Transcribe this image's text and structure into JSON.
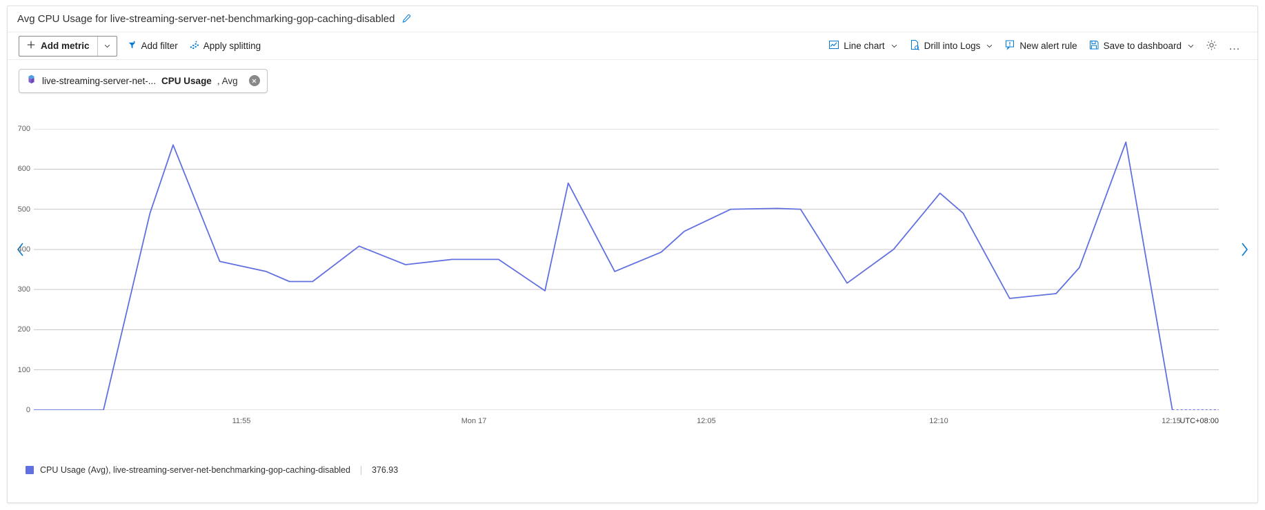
{
  "header": {
    "title": "Avg CPU Usage for live-streaming-server-net-benchmarking-gop-caching-disabled",
    "edit_icon": "pencil-icon"
  },
  "toolbar": {
    "add_metric_label": "Add metric",
    "add_filter_label": "Add filter",
    "apply_splitting_label": "Apply splitting",
    "chart_type_label": "Line chart",
    "drill_into_logs_label": "Drill into Logs",
    "new_alert_rule_label": "New alert rule",
    "save_to_dashboard_label": "Save to dashboard",
    "settings_icon": "gear-icon",
    "more_label": "…"
  },
  "metric_chip": {
    "resource_icon": "vm-resource-icon",
    "resource": "live-streaming-server-net-...",
    "metric": "CPU Usage",
    "aggregation": ", Avg",
    "close_icon": "close-icon"
  },
  "navigation": {
    "previous_icon": "chevron-left-icon",
    "next_icon": "chevron-right-icon"
  },
  "legend": {
    "swatch_color": "#6170e0",
    "text": "CPU Usage (Avg), live-streaming-server-net-benchmarking-gop-caching-disabled",
    "value": "376.93"
  },
  "colors": {
    "series": "#6170e0",
    "accent": "#0078d4",
    "grid": "#c8c6c4",
    "axis_text": "#605e5c"
  },
  "chart_data": {
    "type": "line",
    "title": "Avg CPU Usage for live-streaming-server-net-benchmarking-gop-caching-disabled",
    "xlabel": "",
    "ylabel": "",
    "timezone": "UTC+08:00",
    "ylim": [
      0,
      700
    ],
    "yticks": [
      0,
      100,
      200,
      300,
      400,
      500,
      600,
      700
    ],
    "ytick_labels": [
      "0",
      "100",
      "200",
      "300",
      "400",
      "500",
      "600",
      "700"
    ],
    "xticks": [
      0.1752,
      0.3714,
      0.5675,
      0.7637,
      0.9598
    ],
    "xtick_labels": [
      "11:55",
      "Mon 17",
      "12:05",
      "12:10",
      "12:15"
    ],
    "grid": true,
    "legend_position": "bottom-left",
    "series": [
      {
        "name": "CPU Usage (Avg), live-streaming-server-net-benchmarking-gop-caching-disabled",
        "color": "#6170e0",
        "current_value": 376.93,
        "x": [
          0.0,
          0.0392,
          0.0588,
          0.098,
          0.1176,
          0.1569,
          0.1961,
          0.2157,
          0.2353,
          0.2745,
          0.3137,
          0.3529,
          0.3922,
          0.4314,
          0.451,
          0.4902,
          0.5294,
          0.549,
          0.5882,
          0.6275,
          0.6471,
          0.6863,
          0.7255,
          0.7647,
          0.7843,
          0.8235,
          0.8627,
          0.8824,
          0.9216,
          0.9608,
          1.0
        ],
        "values": [
          0,
          0,
          0,
          490,
          660,
          370,
          345,
          320,
          320,
          408,
          362,
          375,
          375,
          297,
          565,
          345,
          393,
          445,
          500,
          502,
          500,
          316,
          400,
          540,
          490,
          278,
          290,
          355,
          667,
          0,
          0
        ],
        "dashed_tail": true
      }
    ]
  }
}
